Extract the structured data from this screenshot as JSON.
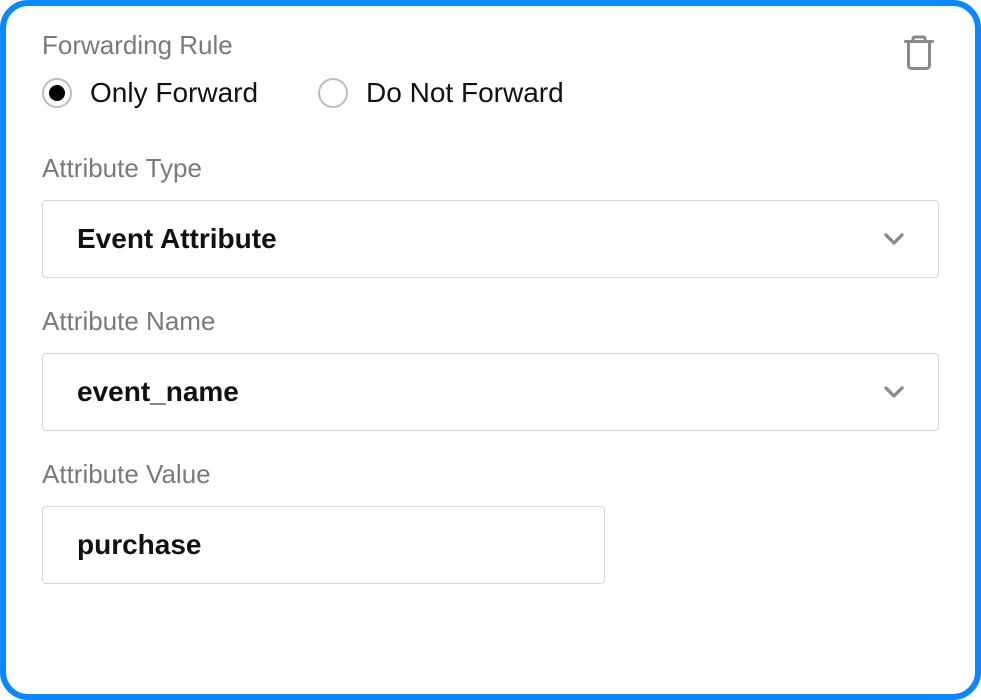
{
  "header": {
    "title": "Forwarding Rule"
  },
  "radio": {
    "options": {
      "only_forward": "Only Forward",
      "do_not_forward": "Do Not Forward"
    },
    "selected": "only_forward"
  },
  "fields": {
    "attribute_type": {
      "label": "Attribute Type",
      "value": "Event Attribute"
    },
    "attribute_name": {
      "label": "Attribute Name",
      "value": "event_name"
    },
    "attribute_value": {
      "label": "Attribute Value",
      "value": "purchase"
    }
  },
  "icons": {
    "trash": "trash-icon",
    "chevron": "chevron-down-icon"
  }
}
